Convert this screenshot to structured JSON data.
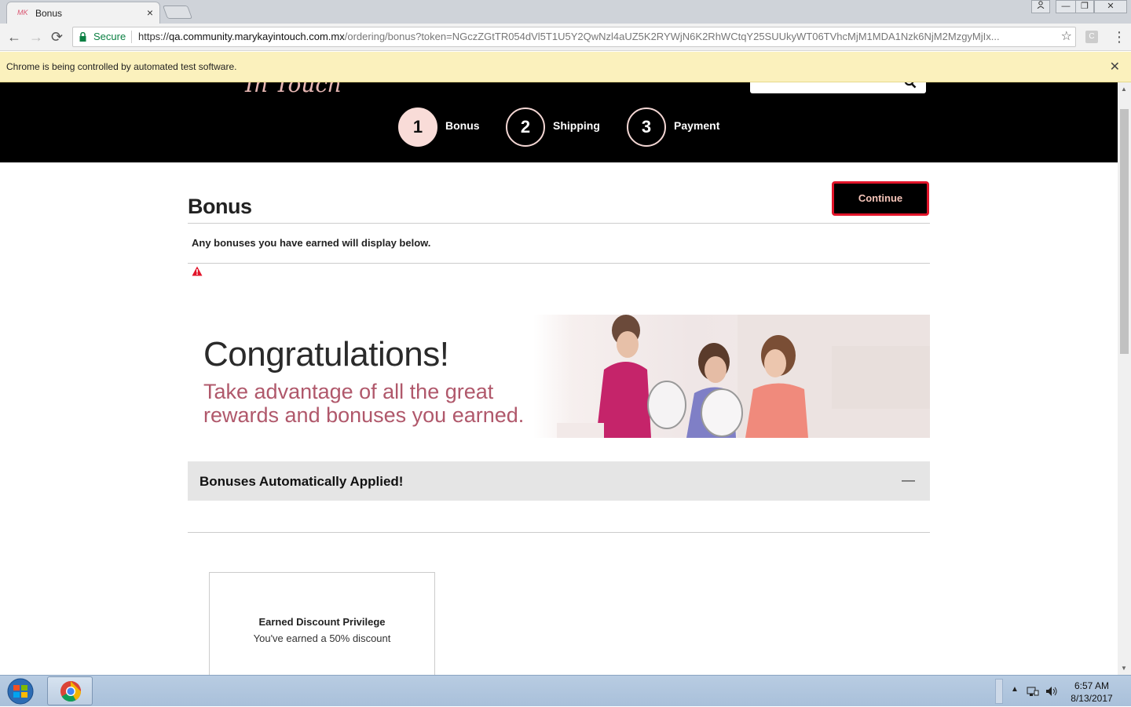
{
  "browser": {
    "tab_favicon": "MK",
    "tab_title": "Bonus",
    "tab_close": "×",
    "secure_label": "Secure",
    "url_scheme": "https://",
    "url_host": "qa.community.marykayintouch.com.mx",
    "url_path": "/ordering/bonus?token=NGczZGtTR054dVl5T1U5Y2QwNzl4aUZ5K2RYWjN6K2RhWCtqY25SUUkyWT06TVhcMjM1MDA1Nzk6NjM2MzgyMjIx...",
    "infobar_message": "Chrome is being controlled by automated test software.",
    "infobar_close": "✕",
    "ext_letter": "C",
    "back": "←",
    "forward": "→",
    "reload": "⟳",
    "star": "☆",
    "menu": "⋮",
    "win_controls": [
      "🔔",
      "—",
      "❐",
      "✕"
    ]
  },
  "header": {
    "logo_text": "In Touch",
    "steps": [
      {
        "number": "1",
        "label": "Bonus",
        "active": true
      },
      {
        "number": "2",
        "label": "Shipping",
        "active": false
      },
      {
        "number": "3",
        "label": "Payment",
        "active": false
      }
    ]
  },
  "page": {
    "title": "Bonus",
    "continue_label": "Continue",
    "description": "Any bonuses you have earned will display below."
  },
  "banner": {
    "headline": "Congratulations!",
    "sub_line1": "Take advantage of all the great",
    "sub_line2": "rewards and bonuses you earned."
  },
  "accordion": {
    "label": "Bonuses Automatically Applied!",
    "toggle": "—"
  },
  "card": {
    "title": "Earned Discount Privilege",
    "subtitle": "You've earned a 50% discount"
  },
  "taskbar": {
    "time": "6:57 AM",
    "date": "8/13/2017"
  },
  "colors": {
    "accent_pink": "#f9dcd8",
    "continue_border": "#e2152a",
    "banner_text": "#b0586b",
    "secure_green": "#0b8043"
  }
}
